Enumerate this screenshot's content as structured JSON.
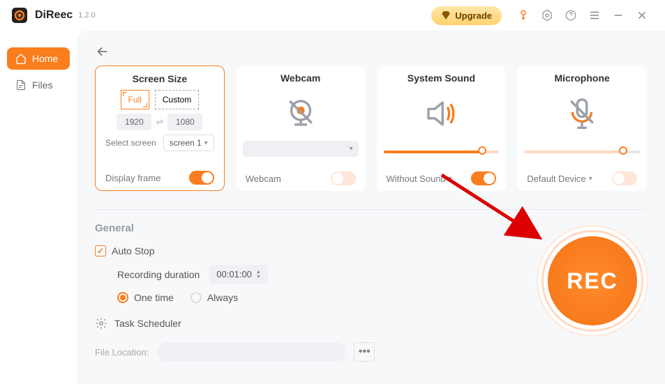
{
  "app": {
    "name": "DiReec",
    "version": "1.2.0"
  },
  "titlebar": {
    "upgrade": "Upgrade"
  },
  "sidebar": {
    "items": [
      {
        "label": "Home"
      },
      {
        "label": "Files"
      }
    ]
  },
  "cards": {
    "screen": {
      "title": "Screen Size",
      "full": "Full",
      "custom": "Custom",
      "width": "1920",
      "height": "1080",
      "select_label": "Select screen",
      "select_value": "screen 1",
      "display_frame": "Display frame"
    },
    "webcam": {
      "title": "Webcam",
      "footer_label": "Webcam",
      "dropdown_value": ""
    },
    "system_sound": {
      "title": "System Sound",
      "footer_label": "Without Sound"
    },
    "microphone": {
      "title": "Microphone",
      "footer_label": "Default Device"
    }
  },
  "general": {
    "title": "General",
    "auto_stop": "Auto Stop",
    "duration_label": "Recording duration",
    "duration_value": "00:01:00",
    "one_time": "One time",
    "always": "Always",
    "task_scheduler": "Task Scheduler",
    "file_location_label": "File Location:"
  },
  "rec": {
    "label": "REC"
  }
}
